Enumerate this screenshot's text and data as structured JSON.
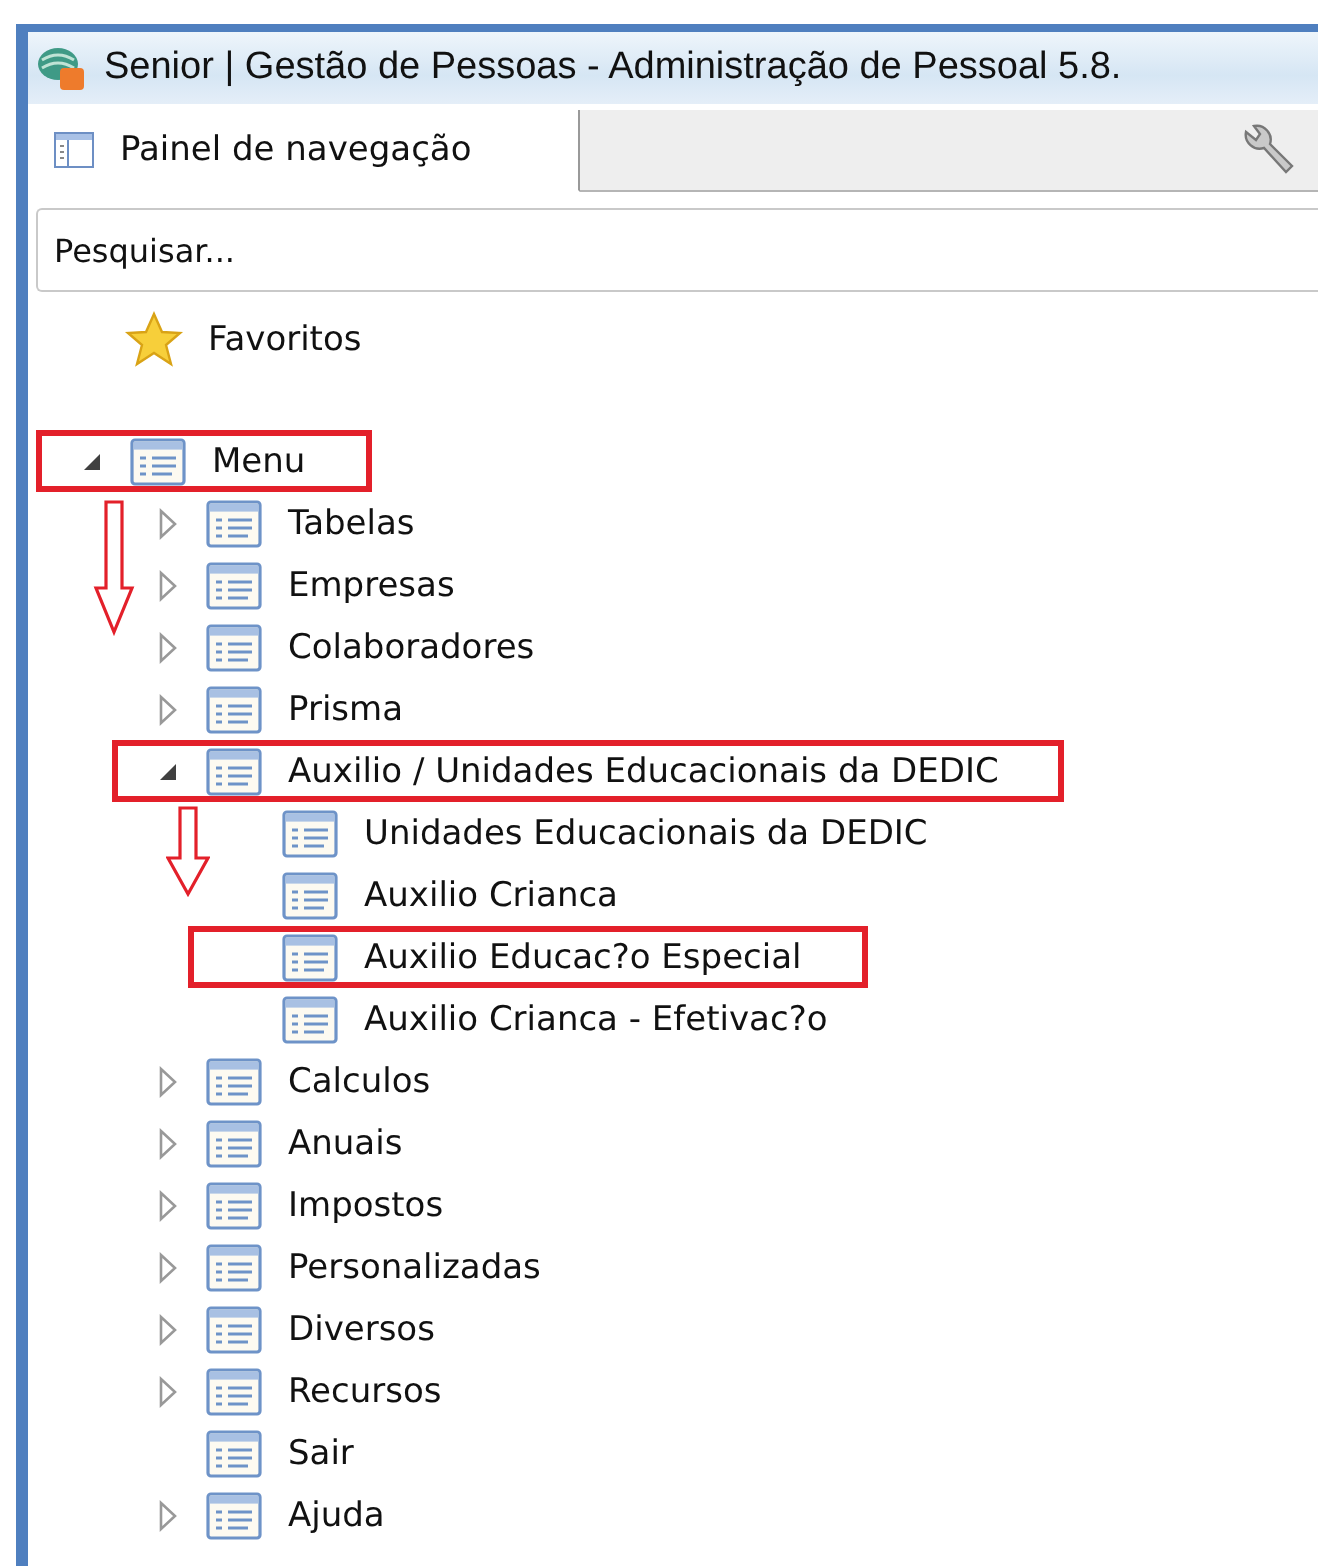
{
  "window": {
    "title": "Senior | Gestão de Pessoas - Administração de Pessoal 5.8."
  },
  "tabs": [
    {
      "label": "Painel de navegação",
      "selected": true
    }
  ],
  "search": {
    "placeholder": "Pesquisar..."
  },
  "favorites": {
    "label": "Favoritos"
  },
  "tree": [
    {
      "label": "Menu",
      "expanded": true,
      "highlighted": true,
      "children": [
        {
          "label": "Tabelas",
          "expanded": false,
          "arrow": true
        },
        {
          "label": "Empresas",
          "expanded": false
        },
        {
          "label": "Colaboradores",
          "expanded": false
        },
        {
          "label": "Prisma",
          "expanded": false
        },
        {
          "label": "Auxilio / Unidades Educacionais da DEDIC",
          "expanded": true,
          "highlighted": true,
          "children": [
            {
              "label": "Unidades Educacionais da DEDIC",
              "arrow": true
            },
            {
              "label": "Auxilio Crianca"
            },
            {
              "label": "Auxilio Educac?o Especial",
              "highlighted": true
            },
            {
              "label": "Auxilio Crianca - Efetivac?o"
            }
          ]
        },
        {
          "label": "Calculos",
          "expanded": false
        },
        {
          "label": "Anuais",
          "expanded": false
        },
        {
          "label": "Impostos",
          "expanded": false
        },
        {
          "label": "Personalizadas",
          "expanded": false
        },
        {
          "label": "Diversos",
          "expanded": false
        },
        {
          "label": "Recursos",
          "expanded": false
        },
        {
          "label": "Sair"
        },
        {
          "label": "Ajuda",
          "expanded": false
        }
      ]
    }
  ]
}
